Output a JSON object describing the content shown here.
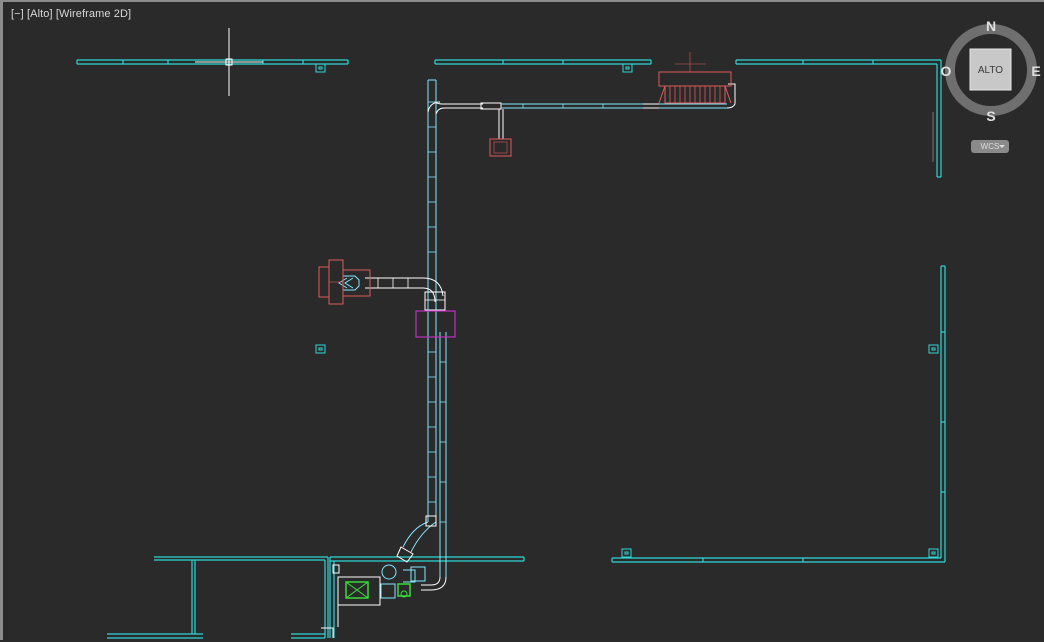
{
  "viewport": {
    "control_menu": "[−]",
    "view_name": "[Alto]",
    "visual_style": "[Wireframe 2D]"
  },
  "viewcube": {
    "face_label": "ALTO",
    "north": "N",
    "south": "S",
    "east": "E",
    "west": "O",
    "ucs_menu_label": "WCS"
  },
  "colors": {
    "background": "#2a2a2b",
    "walls": "#2fd6d6",
    "duct": "#7fe8ff",
    "fittings": "#ffffff",
    "equipment_red": "#e05a5a",
    "equipment_magenta": "#c030c0",
    "equipment_green": "#39e639",
    "crosshair": "#ffffff"
  }
}
